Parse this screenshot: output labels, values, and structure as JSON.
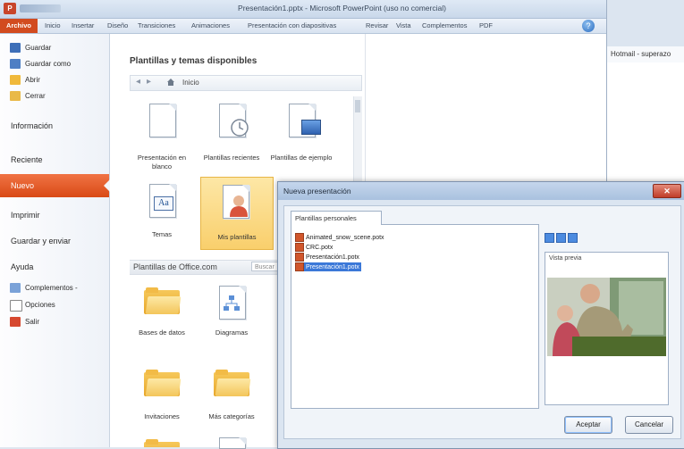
{
  "window": {
    "title": "Presentación1.pptx - Microsoft PowerPoint (uso no comercial)",
    "app_icon_letter": "P"
  },
  "ribbon": {
    "tabs": [
      {
        "label": "Archivo"
      },
      {
        "label": "Inicio"
      },
      {
        "label": "Insertar"
      },
      {
        "label": "Diseño"
      },
      {
        "label": "Transiciones"
      },
      {
        "label": "Animaciones"
      },
      {
        "label": "Presentación con diapositivas"
      },
      {
        "label": "Revisar"
      },
      {
        "label": "Vista"
      },
      {
        "label": "Complementos"
      },
      {
        "label": "PDF"
      }
    ]
  },
  "sidebar": {
    "items": [
      {
        "label": "Guardar",
        "icon": "save-icon"
      },
      {
        "label": "Guardar como",
        "icon": "save-as-icon"
      },
      {
        "label": "Abrir",
        "icon": "open-folder-icon"
      },
      {
        "label": "Cerrar",
        "icon": "close-file-icon"
      },
      {
        "label": "Información"
      },
      {
        "label": "Reciente"
      },
      {
        "label": "Nuevo"
      },
      {
        "label": "Imprimir"
      },
      {
        "label": "Guardar y enviar"
      },
      {
        "label": "Ayuda"
      },
      {
        "label": "Complementos -",
        "icon": "addins-icon"
      },
      {
        "label": "Opciones",
        "icon": "options-icon"
      },
      {
        "label": "Salir",
        "icon": "exit-icon"
      }
    ]
  },
  "main": {
    "heading": "Plantillas y temas disponibles",
    "nav_label": "Inicio",
    "tiles": [
      {
        "label": "Presentación en blanco"
      },
      {
        "label": "Plantillas recientes"
      },
      {
        "label": "Plantillas de ejemplo"
      },
      {
        "label": "Temas"
      },
      {
        "label": "Mis plantillas"
      }
    ],
    "office_section": {
      "label": "Plantillas de Office.com",
      "search_placeholder": "Buscar"
    },
    "office_tiles": [
      {
        "label": "Bases de datos"
      },
      {
        "label": "Diagramas"
      },
      {
        "label": "Invitaciones"
      },
      {
        "label": "Más categorías"
      }
    ]
  },
  "background_window": {
    "tab_label": "Hotmail - superazo"
  },
  "dialog": {
    "title": "Nueva presentación",
    "tab_label": "Plantillas personales",
    "files": [
      {
        "name": "Animated_snow_scene.potx"
      },
      {
        "name": "CRC.potx"
      },
      {
        "name": "Presentación1.potx"
      },
      {
        "name": "Presentación1.potx",
        "selected": true
      }
    ],
    "preview_label": "Vista previa",
    "accept_label": "Aceptar",
    "cancel_label": "Cancelar",
    "close_glyph": "✕"
  }
}
